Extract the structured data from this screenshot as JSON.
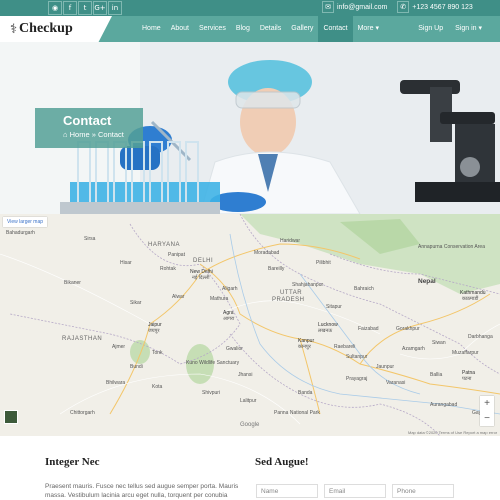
{
  "topbar": {
    "social": [
      {
        "icon": "rss-icon",
        "glyph": "◉"
      },
      {
        "icon": "facebook-icon",
        "glyph": "f"
      },
      {
        "icon": "twitter-icon",
        "glyph": "t"
      },
      {
        "icon": "google-plus-icon",
        "glyph": "G+"
      },
      {
        "icon": "linkedin-icon",
        "glyph": "in"
      }
    ],
    "email": "info@gmail.com",
    "phone": "+123 4567 890 123"
  },
  "nav": {
    "brand": "Checkup",
    "items": [
      "Home",
      "About",
      "Services",
      "Blog",
      "Details",
      "Gallery",
      "Contact",
      "More ▾"
    ],
    "active": "Contact",
    "signup": "Sign Up",
    "signin": "Sign in ▾"
  },
  "hero": {
    "title": "Contact",
    "breadcrumb_home": "Home",
    "breadcrumb_sep": "»",
    "breadcrumb_current": "Contact"
  },
  "map": {
    "view_larger": "View larger map",
    "labels": [
      {
        "t": "HARYANA",
        "c": "big"
      },
      {
        "t": "DELHI",
        "c": "big"
      },
      {
        "t": "New Delhi",
        "c": "city"
      },
      {
        "t": "नई दिल्ली",
        "c": ""
      },
      {
        "t": "UTTAR",
        "c": "big"
      },
      {
        "t": "PRADESH",
        "c": "big"
      },
      {
        "t": "RAJASTHAN",
        "c": "big"
      },
      {
        "t": "Nepal",
        "c": "country"
      },
      {
        "t": "Jaipur",
        "c": "city"
      },
      {
        "t": "जयपुर",
        "c": ""
      },
      {
        "t": "Agra",
        "c": "city"
      },
      {
        "t": "आगरा",
        "c": ""
      },
      {
        "t": "Lucknow",
        "c": "city"
      },
      {
        "t": "लखनऊ",
        "c": ""
      },
      {
        "t": "Kanpur",
        "c": "city"
      },
      {
        "t": "कानपुर",
        "c": ""
      },
      {
        "t": "Kathmandu",
        "c": "city"
      },
      {
        "t": "काठमाडौं",
        "c": ""
      },
      {
        "t": "Patna",
        "c": "city"
      },
      {
        "t": "पटना",
        "c": ""
      },
      {
        "t": "Bikaner",
        "c": ""
      },
      {
        "t": "Ajmer",
        "c": ""
      },
      {
        "t": "Kota",
        "c": ""
      },
      {
        "t": "Bhilwara",
        "c": ""
      },
      {
        "t": "Gwalior",
        "c": ""
      },
      {
        "t": "Jhansi",
        "c": ""
      },
      {
        "t": "Prayagraj",
        "c": ""
      },
      {
        "t": "Varanasi",
        "c": ""
      },
      {
        "t": "Gorakhpur",
        "c": ""
      },
      {
        "t": "Bareilly",
        "c": ""
      },
      {
        "t": "Moradabad",
        "c": ""
      },
      {
        "t": "Aligarh",
        "c": ""
      },
      {
        "t": "Mathura",
        "c": ""
      },
      {
        "t": "Haridwar",
        "c": ""
      },
      {
        "t": "Panipat",
        "c": ""
      },
      {
        "t": "Rohtak",
        "c": ""
      },
      {
        "t": "Hisar",
        "c": ""
      },
      {
        "t": "Sikar",
        "c": ""
      },
      {
        "t": "Alwar",
        "c": ""
      },
      {
        "t": "Tonk",
        "c": ""
      },
      {
        "t": "Bundi",
        "c": ""
      },
      {
        "t": "Shivpuri",
        "c": ""
      },
      {
        "t": "Lalitpur",
        "c": ""
      },
      {
        "t": "Banda",
        "c": ""
      },
      {
        "t": "Raebareli",
        "c": ""
      },
      {
        "t": "Faizabad",
        "c": ""
      },
      {
        "t": "Sultanpur",
        "c": ""
      },
      {
        "t": "Azamgarh",
        "c": ""
      },
      {
        "t": "Jaunpur",
        "c": ""
      },
      {
        "t": "Ballia",
        "c": ""
      },
      {
        "t": "Siwan",
        "c": ""
      },
      {
        "t": "Darbhanga",
        "c": ""
      },
      {
        "t": "Muzaffarpur",
        "c": ""
      },
      {
        "t": "Aurangabad",
        "c": ""
      },
      {
        "t": "Gaya",
        "c": ""
      },
      {
        "t": "Annapurna Conservation Area",
        "c": ""
      },
      {
        "t": "Panna National Park",
        "c": ""
      },
      {
        "t": "Kuno Wildlife Sanctuary",
        "c": ""
      },
      {
        "t": "Chittorgarh",
        "c": ""
      },
      {
        "t": "Bahadurgarh",
        "c": ""
      },
      {
        "t": "Sirsa",
        "c": ""
      },
      {
        "t": "Pilibhit",
        "c": ""
      },
      {
        "t": "Shahjahanpur",
        "c": ""
      },
      {
        "t": "Sitapur",
        "c": ""
      },
      {
        "t": "Bahraich",
        "c": ""
      }
    ],
    "zoom_in": "+",
    "zoom_out": "−",
    "google": "Google",
    "footer": "Map data ©2020  Terms of Use  Report a map error"
  },
  "section_left": {
    "title": "Integer Nec",
    "text": "Praesent mauris. Fusce nec tellus sed augue semper porta. Mauris massa. Vestibulum lacinia arcu eget nulla, torquent per conubia"
  },
  "section_right": {
    "title": "Sed Augue!",
    "name_placeholder": "Name",
    "email_placeholder": "Email",
    "phone_placeholder": "Phone"
  },
  "colors": {
    "topbar": "#3f8f87",
    "nav": "#5ba89e",
    "nav_active": "#3f8f87",
    "hero_box": "#54a096"
  }
}
